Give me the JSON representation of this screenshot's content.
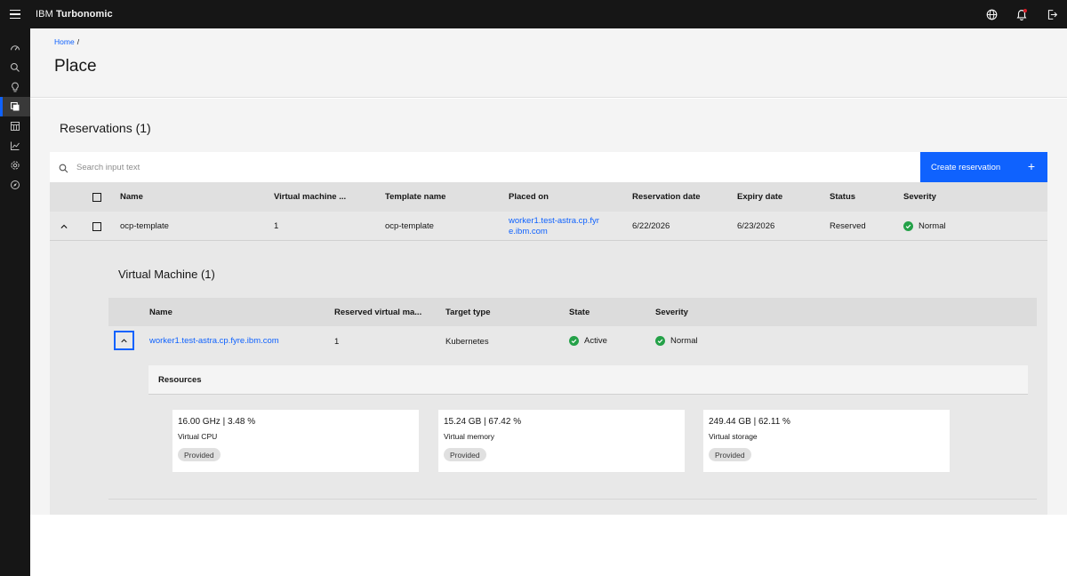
{
  "header": {
    "brand_prefix": "IBM",
    "brand_name": "Turbonomic",
    "icons": [
      "globe-icon",
      "notification-icon",
      "logout-icon"
    ],
    "notification_dot_color": "#da1e28"
  },
  "sidenav": {
    "items": [
      "dashboard-icon",
      "search-icon",
      "lightbulb-icon",
      "place-icon",
      "planner-icon",
      "chart-icon",
      "settings-icon",
      "compass-icon"
    ],
    "active_index": 3
  },
  "breadcrumb": {
    "home": "Home",
    "separator": "/"
  },
  "page": {
    "title": "Place"
  },
  "reservations": {
    "title": "Reservations (1)",
    "search_placeholder": "Search input text",
    "create_label": "Create reservation",
    "create_icon": "+",
    "columns": [
      "Name",
      "Virtual machine ...",
      "Template name",
      "Placed on",
      "Reservation date",
      "Expiry date",
      "Status",
      "Severity"
    ],
    "row": {
      "name": "ocp-template",
      "vm_count": "1",
      "template": "ocp-template",
      "placed_on_line1": "worker1.test-astra.cp.fyr",
      "placed_on_line2": "e.ibm.com",
      "reservation_date": "6/22/2026",
      "expiry_date": "6/23/2026",
      "status": "Reserved",
      "severity": "Normal"
    }
  },
  "vm": {
    "title": "Virtual Machine (1)",
    "columns": [
      "Name",
      "Reserved virtual ma...",
      "Target type",
      "State",
      "Severity"
    ],
    "row": {
      "name": "worker1.test-astra.cp.fyre.ibm.com",
      "reserved": "1",
      "target_type": "Kubernetes",
      "state": "Active",
      "severity": "Normal"
    }
  },
  "resources": {
    "title": "Resources",
    "cards": [
      {
        "value": "16.00 GHz | 3.48 %",
        "label": "Virtual CPU",
        "tag": "Provided"
      },
      {
        "value": "15.24 GB | 67.42 %",
        "label": "Virtual memory",
        "tag": "Provided"
      },
      {
        "value": "249.44 GB | 62.11 %",
        "label": "Virtual storage",
        "tag": "Provided"
      }
    ]
  },
  "colors": {
    "accent": "#0f62fe",
    "success": "#24a148",
    "header_bg": "#161616"
  }
}
